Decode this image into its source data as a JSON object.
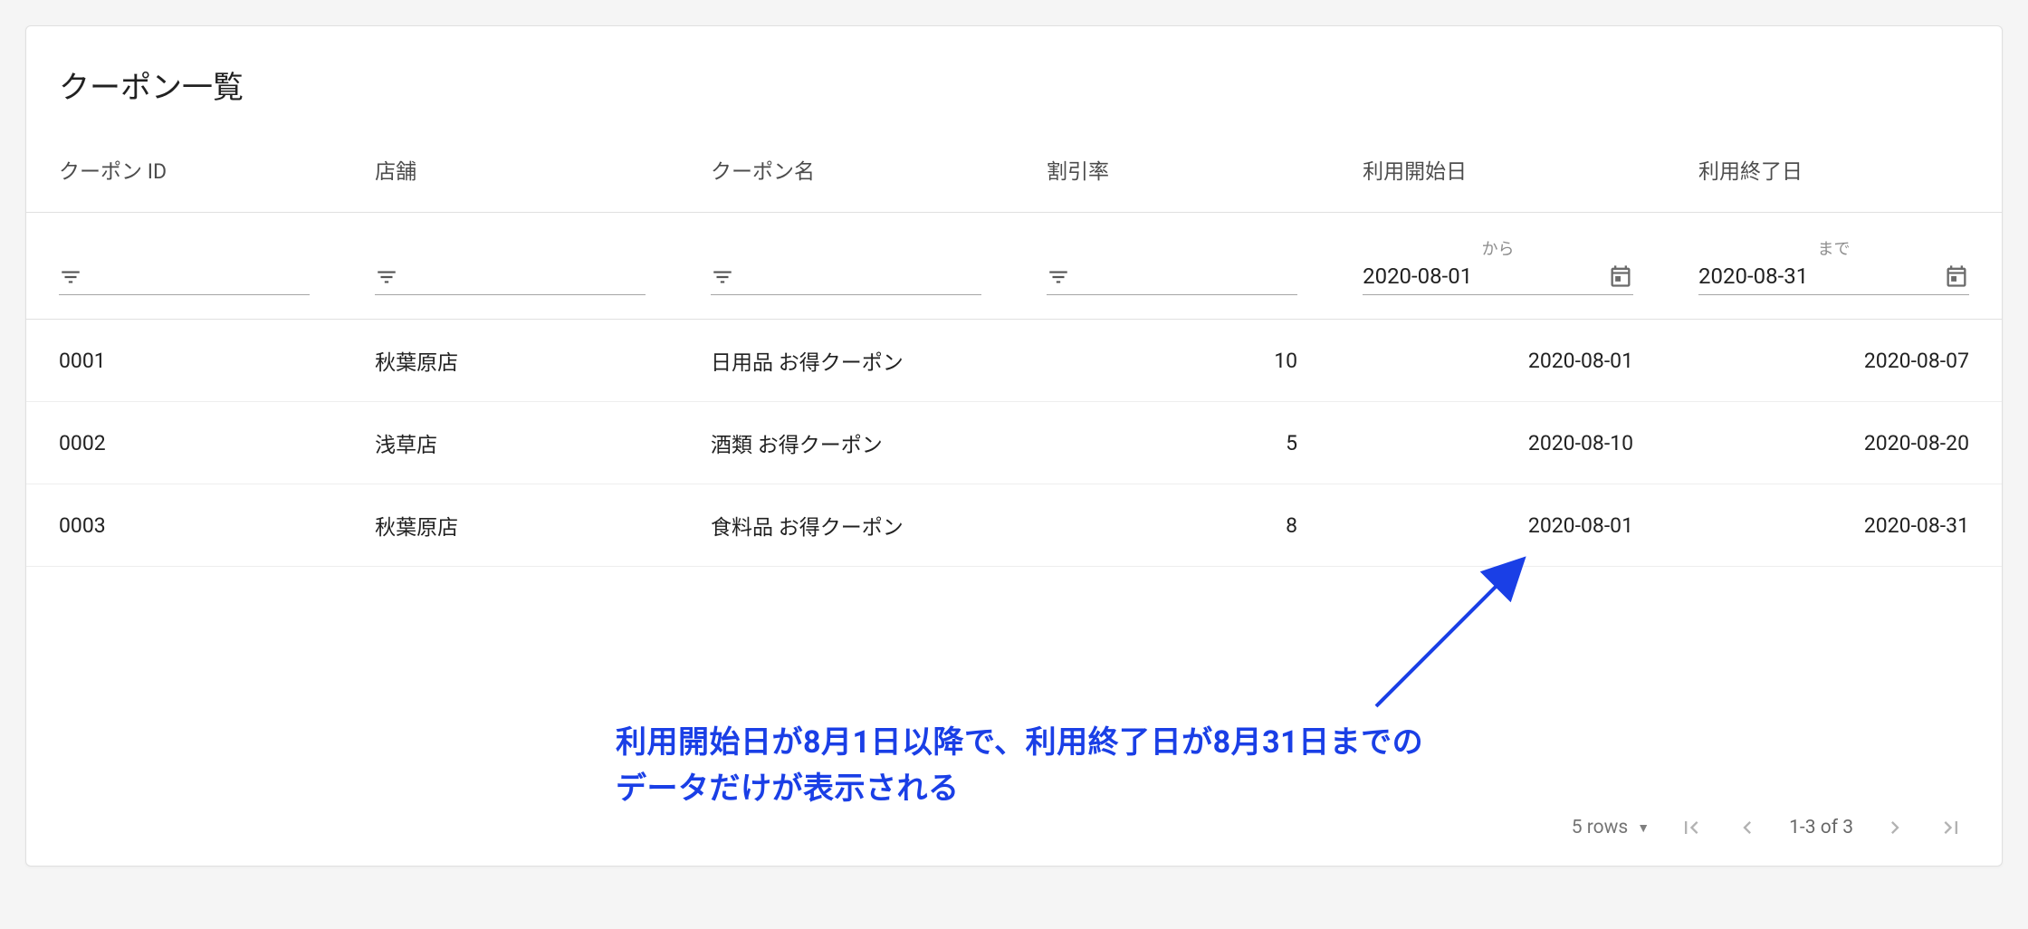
{
  "title": "クーポン一覧",
  "columns": {
    "coupon_id": "クーポン ID",
    "store": "店舗",
    "coupon_name": "クーポン名",
    "discount": "割引率",
    "start_date": "利用開始日",
    "end_date": "利用終了日"
  },
  "filters": {
    "start_date": {
      "label": "から",
      "value": "2020-08-01"
    },
    "end_date": {
      "label": "まで",
      "value": "2020-08-31"
    }
  },
  "rows": [
    {
      "coupon_id": "0001",
      "store": "秋葉原店",
      "coupon_name": "日用品 お得クーポン",
      "discount": "10",
      "start_date": "2020-08-01",
      "end_date": "2020-08-07"
    },
    {
      "coupon_id": "0002",
      "store": "浅草店",
      "coupon_name": "酒類 お得クーポン",
      "discount": "5",
      "start_date": "2020-08-10",
      "end_date": "2020-08-20"
    },
    {
      "coupon_id": "0003",
      "store": "秋葉原店",
      "coupon_name": "食料品 お得クーポン",
      "discount": "8",
      "start_date": "2020-08-01",
      "end_date": "2020-08-31"
    }
  ],
  "pagination": {
    "rows_label": "5 rows",
    "range_label": "1-3 of 3"
  },
  "annotation": {
    "line1": "利用開始日が8月1日以降で、利用終了日が8月31日までの",
    "line2": "データだけが表示される"
  }
}
